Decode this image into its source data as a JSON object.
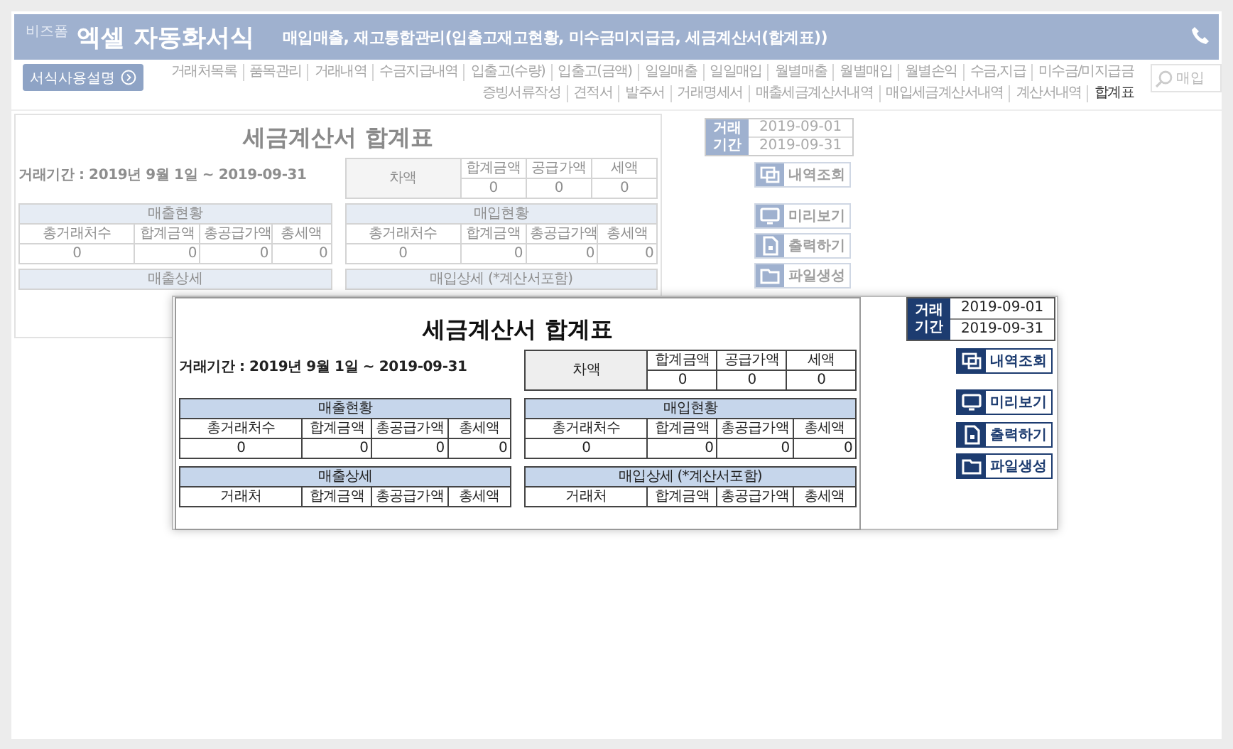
{
  "header": {
    "brand": "비즈폼",
    "title": "엑셀 자동화서식",
    "subtitle": "매입매출, 재고통합관리(입출고재고현황, 미수금미지급금, 세금계산서(합계표))"
  },
  "guide_button": {
    "label": "서식사용설명"
  },
  "menu": {
    "rows": [
      {
        "items": [
          {
            "label": "거래처목록",
            "selected": false
          },
          {
            "label": "품목관리",
            "selected": false
          },
          {
            "label": "거래내역",
            "selected": false
          },
          {
            "label": "수금지급내역",
            "selected": false
          },
          {
            "label": "입출고(수량)",
            "selected": false
          },
          {
            "label": "입출고(금액)",
            "selected": false
          },
          {
            "label": "일일매출",
            "selected": false
          },
          {
            "label": "일일매입",
            "selected": false
          },
          {
            "label": "월별매출",
            "selected": false
          },
          {
            "label": "월별매입",
            "selected": false
          },
          {
            "label": "월별손익",
            "selected": false
          },
          {
            "label": "수금,지급",
            "selected": false
          },
          {
            "label": "미수금/미지급금",
            "selected": false
          }
        ]
      },
      {
        "items": [
          {
            "label": "증빙서류작성",
            "selected": false
          },
          {
            "label": "견적서",
            "selected": false
          },
          {
            "label": "발주서",
            "selected": false
          },
          {
            "label": "거래명세서",
            "selected": false
          },
          {
            "label": "매출세금계산서내역",
            "selected": false
          },
          {
            "label": "매입세금계산서내역",
            "selected": false
          },
          {
            "label": "계산서내역",
            "selected": false
          },
          {
            "label": "합계표",
            "selected": true
          }
        ]
      }
    ]
  },
  "search": {
    "placeholder": "매입"
  },
  "background_sheet": {
    "title": "세금계산서 합계표",
    "period": "거래기간 : 2019년 9월 1일 ~ 2019-09-31",
    "difference": {
      "label": "차액",
      "columns": [
        "합계금액",
        "공급가액",
        "세액"
      ],
      "values": [
        "0",
        "0",
        "0"
      ]
    },
    "sections": [
      {
        "title": "매출현황",
        "columns": [
          "총거래처수",
          "합계금액",
          "총공급가액",
          "총세액"
        ],
        "values": [
          "0",
          "0",
          "0",
          "0"
        ]
      },
      {
        "title": "매입현황",
        "columns": [
          "총거래처수",
          "합계금액",
          "총공급가액",
          "총세액"
        ],
        "values": [
          "0",
          "0",
          "0",
          "0"
        ]
      }
    ],
    "details": [
      {
        "title": "매출상세"
      },
      {
        "title": "매입상세 (*계산서포함)"
      }
    ]
  },
  "background_tools": {
    "period_label": "거래 기간",
    "from": "2019-09-01",
    "to": "2019-09-31",
    "buttons": [
      {
        "kind": "lookup",
        "label": "내역조회"
      },
      {
        "kind": "preview",
        "label": "미리보기"
      },
      {
        "kind": "print",
        "label": "출력하기"
      },
      {
        "kind": "file",
        "label": "파일생성"
      }
    ]
  },
  "zoomed_sheet": {
    "title": "세금계산서 합계표",
    "period": "거래기간 : 2019년 9월 1일 ~ 2019-09-31",
    "difference": {
      "label": "차액",
      "columns": [
        "합계금액",
        "공급가액",
        "세액"
      ],
      "values": [
        "0",
        "0",
        "0"
      ]
    },
    "sections": [
      {
        "title": "매출현황",
        "columns": [
          "총거래처수",
          "합계금액",
          "총공급가액",
          "총세액"
        ],
        "values": [
          "0",
          "0",
          "0",
          "0"
        ]
      },
      {
        "title": "매입현황",
        "columns": [
          "총거래처수",
          "합계금액",
          "총공급가액",
          "총세액"
        ],
        "values": [
          "0",
          "0",
          "0",
          "0"
        ]
      }
    ],
    "details": [
      {
        "title": "매출상세",
        "columns": [
          "거래처",
          "합계금액",
          "총공급가액",
          "총세액"
        ]
      },
      {
        "title": "매입상세 (*계산서포함)",
        "columns": [
          "거래처",
          "합계금액",
          "총공급가액",
          "총세액"
        ]
      }
    ]
  },
  "zoomed_tools": {
    "period_label": "거래 기간",
    "from": "2019-09-01",
    "to": "2019-09-31",
    "buttons": [
      {
        "kind": "lookup",
        "label": "내역조회"
      },
      {
        "kind": "preview",
        "label": "미리보기"
      },
      {
        "kind": "print",
        "label": "출력하기"
      },
      {
        "kind": "file",
        "label": "파일생성"
      }
    ]
  }
}
